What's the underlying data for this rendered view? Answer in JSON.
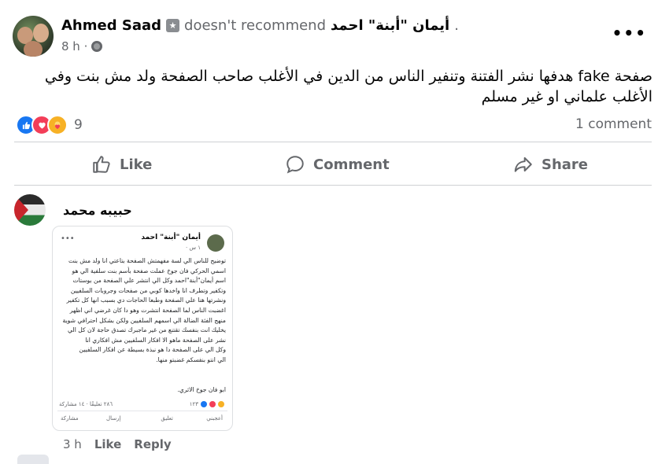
{
  "post": {
    "author": "Ahmed Saad",
    "verb": "doesn't recommend",
    "target_page": "أيمان \"أبنة\" احمد",
    "target_suffix": ".",
    "time": "8 h ·",
    "text": "صفحة fake هدفها نشر الفتنة وتنفير الناس من الدين في الأغلب صاحب الصفحة ولد مش بنت وفي الأغلب علماني او غير مسلم",
    "reaction_count": "9",
    "comment_count": "1 comment"
  },
  "actions": {
    "like": "Like",
    "comment": "Comment",
    "share": "Share"
  },
  "comment": {
    "author": "حبيبه محمد",
    "time": "3 h",
    "like": "Like",
    "reply": "Reply",
    "screenshot": {
      "name": "أيمان \"أبنة\" احمد",
      "time": "١ س ·",
      "lines": [
        "توضيح للناس الي لسة مفهمتش الصفحة بتاعتي انا ولد مش بنت",
        "اسمي الحركي فان جوخ عملت صفحة بأسم بنت سلفية الي هو",
        "اسم أيمان\"أبنة\"احمد وكل الي انتشر علي الصفحة من بوستات",
        "وتكفير وتطرف انا واخدها كوبي من صفحات وجروبات السلفيين",
        "ونشرتها هنا علي الصفحة وطبعا الحاجات دي بسبب انها كل تكفير",
        "اغضبت الناس لما الصفحة انتشرت وهو دا كان غرضي اني اظهر",
        "منهج الفئة الضالة الي اسمهم السلفيين ولكن بشكل احترافي شوية",
        "يخليك انت بنفسك تقتنع من غير ماجبرك تصدق حاجة لان كل الي",
        "نشر على الصفحة ماهو الا افكار السلفيين مش افكاري انا",
        "وكل الي على الصفحة دا هو نبذة بسيطة عن افكار السلفيين",
        "الي انتو بنفسكم غضبتو منها."
      ],
      "signature": "ابو فان جوخ الاثري.",
      "reactions": "١٢٣",
      "stats": "٢٨٦ تعليقًا · ١٤ مشاركة",
      "act_like": "أعجبني",
      "act_comment": "تعليق",
      "act_send": "إرسال",
      "act_share": "مشاركة"
    }
  },
  "colors": {
    "like_blue": "#1877f2",
    "love_red": "#f33e58",
    "care_yellow": "#f7b125",
    "muted": "#65676b"
  },
  "icons": [
    "more-icon",
    "globe-icon",
    "like-icon",
    "comment-icon",
    "share-icon",
    "badge-icon"
  ]
}
